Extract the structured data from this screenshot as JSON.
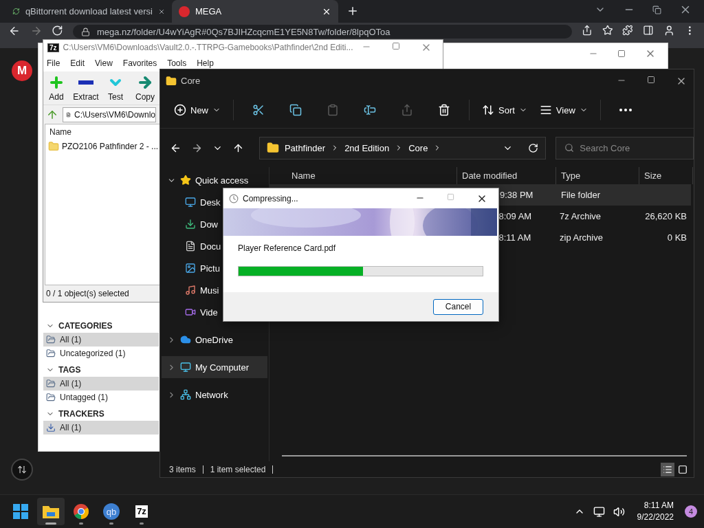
{
  "browser": {
    "tabs": [
      {
        "title": "qBittorrent download latest versi",
        "kind": "qb",
        "selected": false
      },
      {
        "title": "MEGA",
        "kind": "mega",
        "selected": true
      }
    ],
    "url": "mega.nz/folder/U4wYiAgR#0Qs7BJIHZcqcmE1YE5N8Tw/folder/8lpqOToa",
    "logo": "M"
  },
  "qbittorrent": {
    "sections": [
      {
        "title": "CATEGORIES",
        "expanded": true,
        "items": [
          {
            "label": "All (1)",
            "kind": "folder",
            "selected": true
          },
          {
            "label": "Uncategorized (1)",
            "kind": "folder",
            "selected": false
          }
        ]
      },
      {
        "title": "TAGS",
        "expanded": true,
        "items": [
          {
            "label": "All (1)",
            "kind": "folder",
            "selected": true
          },
          {
            "label": "Untagged (1)",
            "kind": "folder",
            "selected": false
          }
        ]
      },
      {
        "title": "TRACKERS",
        "expanded": true,
        "items": [
          {
            "label": "All (1)",
            "kind": "tracker",
            "selected": true
          }
        ]
      }
    ]
  },
  "sevenzip": {
    "logo": "7z",
    "title": "C:\\Users\\VM6\\Downloads\\Vault2.0.-.TTRPG-Gamebooks\\Pathfinder\\2nd Editi...",
    "menu": [
      "File",
      "Edit",
      "View",
      "Favorites",
      "Tools",
      "Help"
    ],
    "toolbar": [
      {
        "label": "Add",
        "kind": "add"
      },
      {
        "label": "Extract",
        "kind": "extract"
      },
      {
        "label": "Test",
        "kind": "test"
      },
      {
        "label": "Copy",
        "kind": "copy"
      }
    ],
    "path": "C:\\Users\\VM6\\Downlo",
    "column": "Name",
    "files": [
      "PZO2106 Pathfinder 2 - ..."
    ],
    "status": "0 / 1 object(s) selected"
  },
  "explorer": {
    "title": "Core",
    "toolbar": [
      {
        "kind": "new",
        "label": "New",
        "disabled": false
      },
      {
        "kind": "cut",
        "disabled": false
      },
      {
        "kind": "copy",
        "disabled": false
      },
      {
        "kind": "paste",
        "disabled": true
      },
      {
        "kind": "rename",
        "disabled": false
      },
      {
        "kind": "share",
        "disabled": true
      },
      {
        "kind": "delete",
        "disabled": false
      },
      {
        "kind": "sort",
        "label": "Sort",
        "disabled": false
      },
      {
        "kind": "view",
        "label": "View",
        "disabled": false
      },
      {
        "kind": "more",
        "disabled": false
      }
    ],
    "breadcrumb": [
      "Pathfinder",
      "2nd Edition",
      "Core"
    ],
    "search": {
      "placeholder": "Search Core"
    },
    "nav": [
      {
        "label": "Quick access",
        "kind": "star",
        "expanded": true,
        "selected": false,
        "children": [
          {
            "label": "Desk",
            "kind": "desktop"
          },
          {
            "label": "Dow",
            "kind": "download"
          },
          {
            "label": "Docu",
            "kind": "document"
          },
          {
            "label": "Pictu",
            "kind": "picture"
          },
          {
            "label": "Musi",
            "kind": "music"
          },
          {
            "label": "Vide",
            "kind": "video"
          }
        ]
      },
      {
        "label": "OneDrive",
        "kind": "cloud",
        "expanded": false,
        "selected": false
      },
      {
        "label": "My Computer",
        "kind": "computer",
        "expanded": false,
        "selected": true
      },
      {
        "label": "Network",
        "kind": "network",
        "expanded": false,
        "selected": false
      }
    ],
    "columns": [
      "Name",
      "Date modified",
      "Type",
      "Size"
    ],
    "rows": [
      {
        "date": "9:38 PM",
        "type": "File folder",
        "selected": true
      },
      {
        "date": "8:09 AM",
        "type": "7z Archive",
        "size": "26,620 KB",
        "selected": false
      },
      {
        "date": "8:11 AM",
        "type": "zip Archive",
        "size": "0 KB",
        "selected": false
      }
    ],
    "status": [
      "3 items",
      "1 item selected"
    ],
    "views": [
      {
        "kind": "details",
        "selected": true
      },
      {
        "kind": "tiles",
        "selected": false
      }
    ]
  },
  "dialog": {
    "title": "Compressing...",
    "file": "Player Reference Card.pdf",
    "level": 0.51,
    "button": "Cancel"
  },
  "taskbar": {
    "apps": [
      {
        "kind": "start",
        "selected": false
      },
      {
        "kind": "explorer",
        "selected": true,
        "running": true
      },
      {
        "kind": "chrome",
        "selected": false,
        "running": true
      },
      {
        "kind": "qb",
        "label": "qb",
        "selected": false,
        "running": true
      },
      {
        "kind": "sevenzip",
        "label": "7z",
        "selected": false,
        "running": true
      }
    ],
    "time": "8:11 AM",
    "date": "9/22/2022",
    "badge": "4"
  }
}
